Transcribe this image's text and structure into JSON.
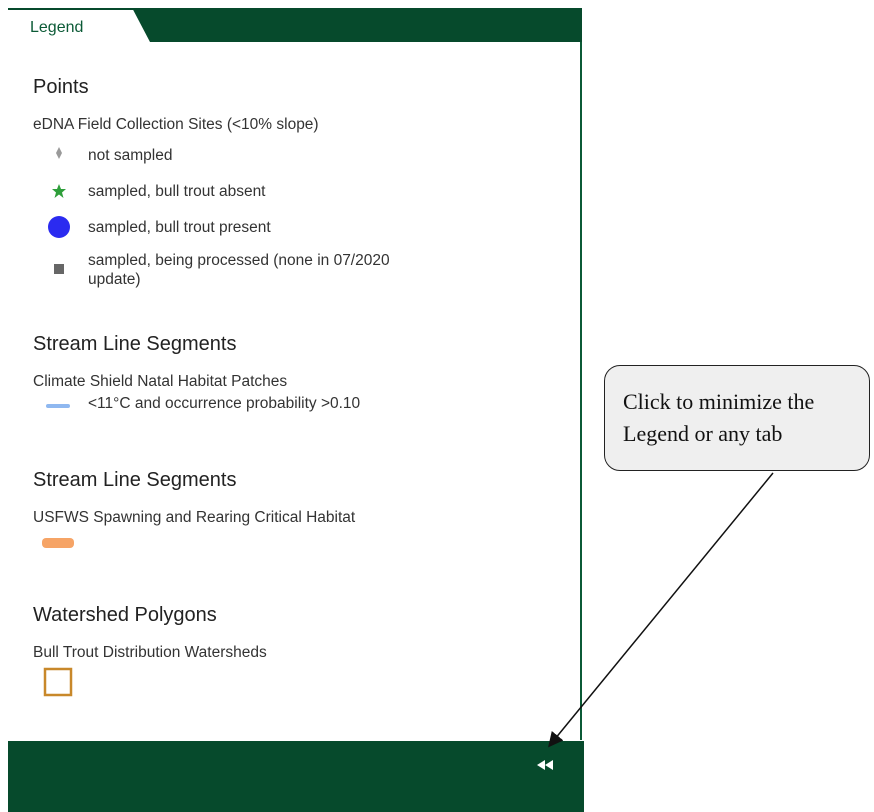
{
  "tab": {
    "label": "Legend"
  },
  "sections": [
    {
      "heading": "Points",
      "subtitle": "eDNA Field Collection Sites (<10% slope)",
      "items": [
        {
          "label": "not sampled",
          "icon": "small-diamond-icon",
          "color": "#9a9a9a"
        },
        {
          "label": "sampled, bull trout absent",
          "icon": "green-star-icon",
          "color": "#2e9e3a"
        },
        {
          "label": "sampled, bull trout present",
          "icon": "blue-circle-icon",
          "color": "#2b2bf0"
        },
        {
          "label_line1": "sampled, being processed (none in 07/2020",
          "label_line2": "update)",
          "icon": "gray-square-icon",
          "color": "#666666"
        }
      ]
    },
    {
      "heading": "Stream Line Segments",
      "subtitle": "Climate Shield Natal Habitat Patches",
      "items": [
        {
          "label": "<11°C and occurrence probability >0.10",
          "icon": "blue-line-icon",
          "color": "#8fb8f0"
        }
      ]
    },
    {
      "heading": "Stream Line Segments",
      "subtitle": "USFWS Spawning and Rearing Critical Habitat",
      "items": [
        {
          "label": "",
          "icon": "orange-line-icon",
          "color": "#f6a466"
        }
      ]
    },
    {
      "heading": "Watershed Polygons",
      "subtitle": "Bull Trout Distribution Watersheds",
      "items": [
        {
          "label": "",
          "icon": "outlined-square-icon",
          "color": "#c8882a"
        }
      ]
    }
  ],
  "footer": {
    "collapse_icon": "double-chevron-left-icon"
  },
  "callout": {
    "line1": "Click to minimize the",
    "line2": "Legend or any tab"
  },
  "colors": {
    "brand_green": "#064a2c",
    "callout_bg": "#efefef"
  }
}
